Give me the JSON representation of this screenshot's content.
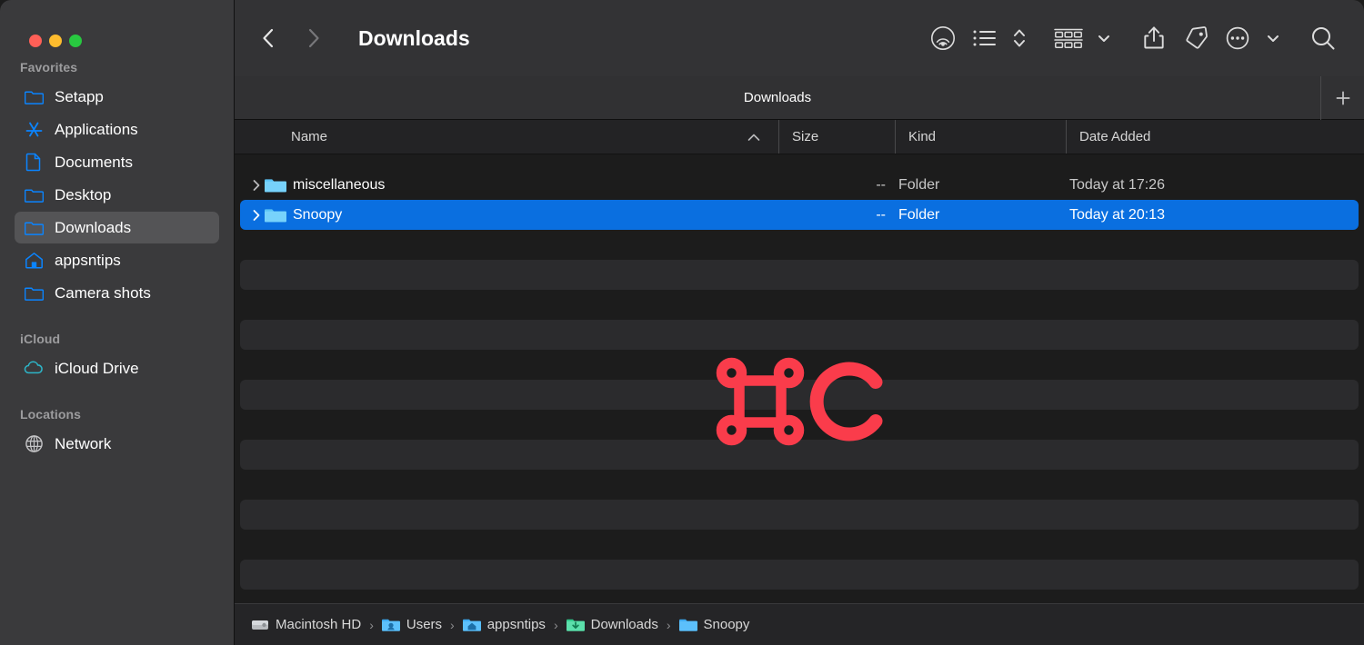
{
  "window": {
    "traffic_lights": [
      {
        "name": "close",
        "color": "#ff5f57"
      },
      {
        "name": "minimize",
        "color": "#febc2e"
      },
      {
        "name": "zoom",
        "color": "#28c840"
      }
    ]
  },
  "sidebar": {
    "sections": [
      {
        "title": "Favorites",
        "items": [
          {
            "label": "Setapp",
            "icon": "folder-icon",
            "selected": false
          },
          {
            "label": "Applications",
            "icon": "applications-icon",
            "selected": false
          },
          {
            "label": "Documents",
            "icon": "document-icon",
            "selected": false
          },
          {
            "label": "Desktop",
            "icon": "folder-icon",
            "selected": false
          },
          {
            "label": "Downloads",
            "icon": "folder-icon",
            "selected": true
          },
          {
            "label": "appsntips",
            "icon": "home-icon",
            "selected": false
          },
          {
            "label": "Camera shots",
            "icon": "folder-icon",
            "selected": false
          }
        ]
      },
      {
        "title": "iCloud",
        "items": [
          {
            "label": "iCloud Drive",
            "icon": "cloud-icon",
            "selected": false
          }
        ]
      },
      {
        "title": "Locations",
        "items": [
          {
            "label": "Network",
            "icon": "globe-icon",
            "selected": false
          }
        ]
      }
    ]
  },
  "toolbar": {
    "back_icon": "chevron-left-icon",
    "forward_icon": "chevron-right-icon",
    "title": "Downloads",
    "buttons": [
      {
        "name": "airdrop-icon",
        "label": "AirDrop"
      },
      {
        "name": "list-view-icon",
        "label": "List View"
      },
      {
        "name": "view-stepper-icon",
        "label": "View Options"
      },
      {
        "name": "group-by-icon",
        "label": "Group By"
      },
      {
        "name": "group-by-chevron-icon",
        "label": "Group By Menu"
      },
      {
        "name": "share-icon",
        "label": "Share"
      },
      {
        "name": "tag-icon",
        "label": "Tags"
      },
      {
        "name": "more-options-icon",
        "label": "More"
      },
      {
        "name": "more-options-chevron-icon",
        "label": "More Menu"
      },
      {
        "name": "search-icon",
        "label": "Search"
      }
    ]
  },
  "tabbar": {
    "tabs": [
      {
        "label": "Downloads",
        "active": true
      }
    ],
    "new_tab_label": "+"
  },
  "columns": [
    {
      "key": "name",
      "label": "Name",
      "sorted": true,
      "sort_direction": "ascending"
    },
    {
      "key": "size",
      "label": "Size",
      "sorted": false
    },
    {
      "key": "kind",
      "label": "Kind",
      "sorted": false
    },
    {
      "key": "date_added",
      "label": "Date Added",
      "sorted": false
    }
  ],
  "files": [
    {
      "name": "miscellaneous",
      "size": "--",
      "kind": "Folder",
      "date_added": "Today at 17:26",
      "selected": false,
      "expandable": true,
      "icon": "folder-icon"
    },
    {
      "name": "Snoopy",
      "size": "--",
      "kind": "Folder",
      "date_added": "Today at 20:13",
      "selected": true,
      "expandable": true,
      "icon": "folder-icon"
    }
  ],
  "shortcut_overlay": {
    "keys": "⌘ C",
    "command_symbol": "⌘",
    "letter": "C",
    "color": "#fa3c4b"
  },
  "pathbar": {
    "items": [
      {
        "label": "Macintosh HD",
        "icon": "hard-drive-icon"
      },
      {
        "label": "Users",
        "icon": "users-folder-icon"
      },
      {
        "label": "appsntips",
        "icon": "home-folder-icon"
      },
      {
        "label": "Downloads",
        "icon": "downloads-folder-icon"
      },
      {
        "label": "Snoopy",
        "icon": "folder-icon"
      }
    ],
    "separator": "›"
  },
  "colors": {
    "sidebar_bg": "#3a3a3c",
    "content_bg": "#1c1c1c",
    "toolbar_bg": "#333335",
    "selection_blue": "#0a6fe0",
    "folder_blue": "#4fb3f0",
    "accent_red": "#fa3c4b"
  }
}
